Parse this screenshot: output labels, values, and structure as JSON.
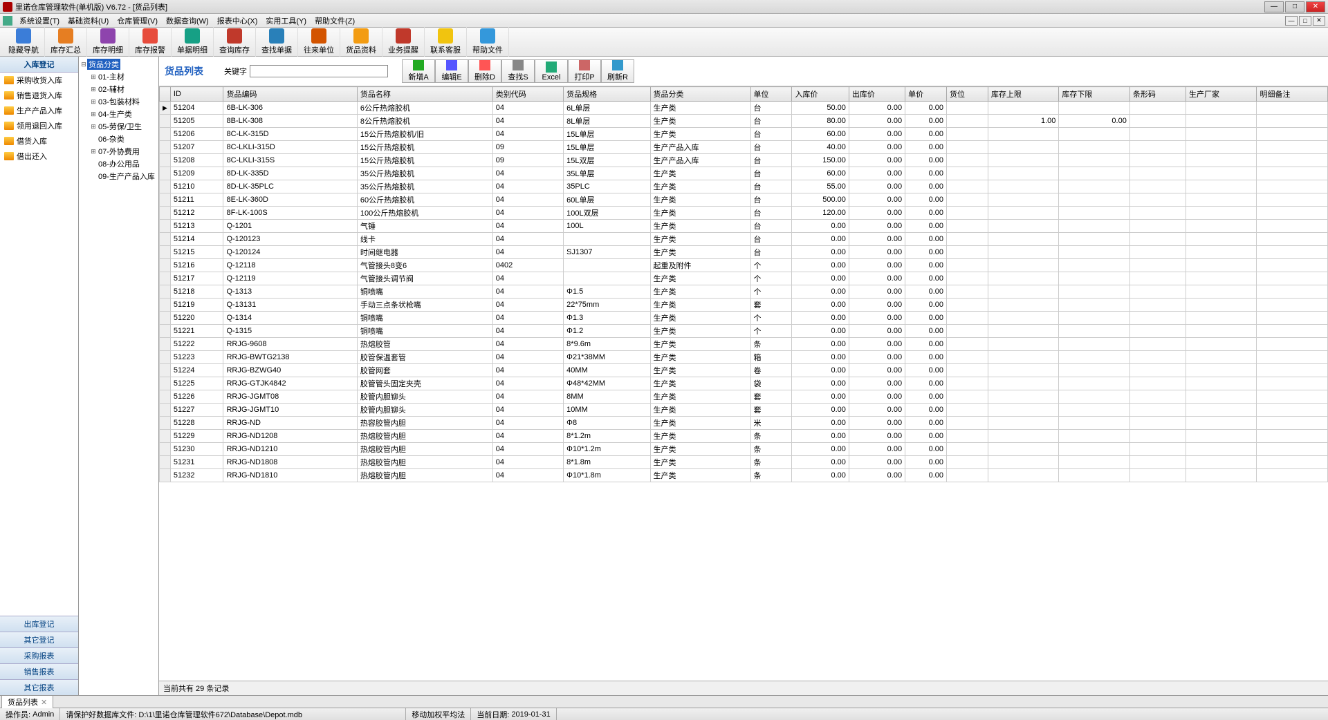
{
  "window": {
    "title": "里诺仓库管理软件(单机版) V6.72 - [货品列表]"
  },
  "menus": [
    "系统设置(T)",
    "基础资料(U)",
    "仓库管理(V)",
    "数据查询(W)",
    "报表中心(X)",
    "实用工具(Y)",
    "帮助文件(Z)"
  ],
  "toolbar": [
    {
      "label": "隐藏导航",
      "color": "#3b7dd8"
    },
    {
      "label": "库存汇总",
      "color": "#e67e22"
    },
    {
      "label": "库存明细",
      "color": "#8e44ad"
    },
    {
      "label": "库存报警",
      "color": "#e74c3c"
    },
    {
      "label": "单据明细",
      "color": "#16a085"
    },
    {
      "label": "查询库存",
      "color": "#c0392b"
    },
    {
      "label": "查找单据",
      "color": "#2980b9"
    },
    {
      "label": "往来单位",
      "color": "#d35400"
    },
    {
      "label": "货品资料",
      "color": "#f39c12"
    },
    {
      "label": "业务提醒",
      "color": "#c0392b"
    },
    {
      "label": "联系客服",
      "color": "#f1c40f"
    },
    {
      "label": "帮助文件",
      "color": "#3498db"
    }
  ],
  "sidebar": {
    "header": "入库登记",
    "items": [
      "采购收货入库",
      "销售退货入库",
      "生产产品入库",
      "领用退回入库",
      "借货入库",
      "借出还入"
    ],
    "bottom": [
      "出库登记",
      "其它登记",
      "采购报表",
      "销售报表",
      "其它报表"
    ]
  },
  "tree": {
    "root": "货品分类",
    "children": [
      {
        "exp": "+",
        "label": "01-主材"
      },
      {
        "exp": "+",
        "label": "02-辅材"
      },
      {
        "exp": "+",
        "label": "03-包装材料"
      },
      {
        "exp": "+",
        "label": "04-生产类"
      },
      {
        "exp": "+",
        "label": "05-劳保/卫生"
      },
      {
        "exp": "",
        "label": "06-杂类"
      },
      {
        "exp": "+",
        "label": "07-外协费用"
      },
      {
        "exp": "",
        "label": "08-办公用品"
      },
      {
        "exp": "",
        "label": "09-生产产品入库"
      }
    ]
  },
  "grid": {
    "title": "货品列表",
    "search_label": "关键字",
    "search_value": "",
    "actions": [
      "新增A",
      "编辑E",
      "删除D",
      "查找S",
      "Excel",
      "打印P",
      "刷新R"
    ],
    "columns": [
      "ID",
      "货品编码",
      "货品名称",
      "类别代码",
      "货品规格",
      "货品分类",
      "单位",
      "入库价",
      "出库价",
      "单价",
      "货位",
      "库存上限",
      "库存下限",
      "条形码",
      "生产厂家",
      "明细备注"
    ],
    "rows": [
      {
        "id": "51204",
        "code": "6B-LK-306",
        "name": "6公斤热熔胶机",
        "cat": "04",
        "spec": "6L单层",
        "cls": "生产类",
        "unit": "台",
        "in": "50.00",
        "out": "0.00",
        "price": "0.00",
        "loc": "",
        "up": "",
        "low": "",
        "bar": "",
        "mfg": "",
        "note": ""
      },
      {
        "id": "51205",
        "code": "8B-LK-308",
        "name": "8公斤热熔胶机",
        "cat": "04",
        "spec": "8L单层",
        "cls": "生产类",
        "unit": "台",
        "in": "80.00",
        "out": "0.00",
        "price": "0.00",
        "loc": "",
        "up": "1.00",
        "low": "0.00",
        "bar": "",
        "mfg": "",
        "note": ""
      },
      {
        "id": "51206",
        "code": "8C-LK-315D",
        "name": "15公斤热熔胶机/旧",
        "cat": "04",
        "spec": "15L单层",
        "cls": "生产类",
        "unit": "台",
        "in": "60.00",
        "out": "0.00",
        "price": "0.00",
        "loc": "",
        "up": "",
        "low": "",
        "bar": "",
        "mfg": "",
        "note": ""
      },
      {
        "id": "51207",
        "code": "8C-LKLI-315D",
        "name": "15公斤热熔胶机",
        "cat": "09",
        "spec": "15L单层",
        "cls": "生产产品入库",
        "unit": "台",
        "in": "40.00",
        "out": "0.00",
        "price": "0.00",
        "loc": "",
        "up": "",
        "low": "",
        "bar": "",
        "mfg": "",
        "note": ""
      },
      {
        "id": "51208",
        "code": "8C-LKLI-315S",
        "name": "15公斤热熔胶机",
        "cat": "09",
        "spec": "15L双层",
        "cls": "生产产品入库",
        "unit": "台",
        "in": "150.00",
        "out": "0.00",
        "price": "0.00",
        "loc": "",
        "up": "",
        "low": "",
        "bar": "",
        "mfg": "",
        "note": ""
      },
      {
        "id": "51209",
        "code": "8D-LK-335D",
        "name": "35公斤热熔胶机",
        "cat": "04",
        "spec": "35L单层",
        "cls": "生产类",
        "unit": "台",
        "in": "60.00",
        "out": "0.00",
        "price": "0.00",
        "loc": "",
        "up": "",
        "low": "",
        "bar": "",
        "mfg": "",
        "note": ""
      },
      {
        "id": "51210",
        "code": "8D-LK-35PLC",
        "name": "35公斤热熔胶机",
        "cat": "04",
        "spec": "35PLC",
        "cls": "生产类",
        "unit": "台",
        "in": "55.00",
        "out": "0.00",
        "price": "0.00",
        "loc": "",
        "up": "",
        "low": "",
        "bar": "",
        "mfg": "",
        "note": ""
      },
      {
        "id": "51211",
        "code": "8E-LK-360D",
        "name": "60公斤热熔胶机",
        "cat": "04",
        "spec": "60L单层",
        "cls": "生产类",
        "unit": "台",
        "in": "500.00",
        "out": "0.00",
        "price": "0.00",
        "loc": "",
        "up": "",
        "low": "",
        "bar": "",
        "mfg": "",
        "note": ""
      },
      {
        "id": "51212",
        "code": "8F-LK-100S",
        "name": "100公斤热熔胶机",
        "cat": "04",
        "spec": "100L双层",
        "cls": "生产类",
        "unit": "台",
        "in": "120.00",
        "out": "0.00",
        "price": "0.00",
        "loc": "",
        "up": "",
        "low": "",
        "bar": "",
        "mfg": "",
        "note": ""
      },
      {
        "id": "51213",
        "code": "Q-1201",
        "name": "气锤",
        "cat": "04",
        "spec": "100L",
        "cls": "生产类",
        "unit": "台",
        "in": "0.00",
        "out": "0.00",
        "price": "0.00",
        "loc": "",
        "up": "",
        "low": "",
        "bar": "",
        "mfg": "",
        "note": ""
      },
      {
        "id": "51214",
        "code": "Q-120123",
        "name": "线卡",
        "cat": "04",
        "spec": "",
        "cls": "生产类",
        "unit": "台",
        "in": "0.00",
        "out": "0.00",
        "price": "0.00",
        "loc": "",
        "up": "",
        "low": "",
        "bar": "",
        "mfg": "",
        "note": ""
      },
      {
        "id": "51215",
        "code": "Q-120124",
        "name": "时间继电器",
        "cat": "04",
        "spec": "SJ1307",
        "cls": "生产类",
        "unit": "台",
        "in": "0.00",
        "out": "0.00",
        "price": "0.00",
        "loc": "",
        "up": "",
        "low": "",
        "bar": "",
        "mfg": "",
        "note": ""
      },
      {
        "id": "51216",
        "code": "Q-12118",
        "name": "气管接头8变6",
        "cat": "0402",
        "spec": "",
        "cls": "起重及附件",
        "unit": "个",
        "in": "0.00",
        "out": "0.00",
        "price": "0.00",
        "loc": "",
        "up": "",
        "low": "",
        "bar": "",
        "mfg": "",
        "note": ""
      },
      {
        "id": "51217",
        "code": "Q-12119",
        "name": "气管接头调节阀",
        "cat": "04",
        "spec": "",
        "cls": "生产类",
        "unit": "个",
        "in": "0.00",
        "out": "0.00",
        "price": "0.00",
        "loc": "",
        "up": "",
        "low": "",
        "bar": "",
        "mfg": "",
        "note": ""
      },
      {
        "id": "51218",
        "code": "Q-1313",
        "name": "铜喷嘴",
        "cat": "04",
        "spec": "Φ1.5",
        "cls": "生产类",
        "unit": "个",
        "in": "0.00",
        "out": "0.00",
        "price": "0.00",
        "loc": "",
        "up": "",
        "low": "",
        "bar": "",
        "mfg": "",
        "note": ""
      },
      {
        "id": "51219",
        "code": "Q-13131",
        "name": "手动三点条状枪嘴",
        "cat": "04",
        "spec": "22*75mm",
        "cls": "生产类",
        "unit": "套",
        "in": "0.00",
        "out": "0.00",
        "price": "0.00",
        "loc": "",
        "up": "",
        "low": "",
        "bar": "",
        "mfg": "",
        "note": ""
      },
      {
        "id": "51220",
        "code": "Q-1314",
        "name": "铜喷嘴",
        "cat": "04",
        "spec": "Φ1.3",
        "cls": "生产类",
        "unit": "个",
        "in": "0.00",
        "out": "0.00",
        "price": "0.00",
        "loc": "",
        "up": "",
        "low": "",
        "bar": "",
        "mfg": "",
        "note": ""
      },
      {
        "id": "51221",
        "code": "Q-1315",
        "name": "铜喷嘴",
        "cat": "04",
        "spec": "Φ1.2",
        "cls": "生产类",
        "unit": "个",
        "in": "0.00",
        "out": "0.00",
        "price": "0.00",
        "loc": "",
        "up": "",
        "low": "",
        "bar": "",
        "mfg": "",
        "note": ""
      },
      {
        "id": "51222",
        "code": "RRJG-9608",
        "name": "热熔胶管",
        "cat": "04",
        "spec": "8*9.6m",
        "cls": "生产类",
        "unit": "条",
        "in": "0.00",
        "out": "0.00",
        "price": "0.00",
        "loc": "",
        "up": "",
        "low": "",
        "bar": "",
        "mfg": "",
        "note": ""
      },
      {
        "id": "51223",
        "code": "RRJG-BWTG2138",
        "name": "胶管保温套管",
        "cat": "04",
        "spec": "Φ21*38MM",
        "cls": "生产类",
        "unit": "箱",
        "in": "0.00",
        "out": "0.00",
        "price": "0.00",
        "loc": "",
        "up": "",
        "low": "",
        "bar": "",
        "mfg": "",
        "note": ""
      },
      {
        "id": "51224",
        "code": "RRJG-BZWG40",
        "name": "胶管网套",
        "cat": "04",
        "spec": "40MM",
        "cls": "生产类",
        "unit": "卷",
        "in": "0.00",
        "out": "0.00",
        "price": "0.00",
        "loc": "",
        "up": "",
        "low": "",
        "bar": "",
        "mfg": "",
        "note": ""
      },
      {
        "id": "51225",
        "code": "RRJG-GTJK4842",
        "name": "胶管管头固定夹壳",
        "cat": "04",
        "spec": "Φ48*42MM",
        "cls": "生产类",
        "unit": "袋",
        "in": "0.00",
        "out": "0.00",
        "price": "0.00",
        "loc": "",
        "up": "",
        "low": "",
        "bar": "",
        "mfg": "",
        "note": ""
      },
      {
        "id": "51226",
        "code": "RRJG-JGMT08",
        "name": "胶管内胆铆头",
        "cat": "04",
        "spec": "8MM",
        "cls": "生产类",
        "unit": "套",
        "in": "0.00",
        "out": "0.00",
        "price": "0.00",
        "loc": "",
        "up": "",
        "low": "",
        "bar": "",
        "mfg": "",
        "note": ""
      },
      {
        "id": "51227",
        "code": "RRJG-JGMT10",
        "name": "胶管内胆铆头",
        "cat": "04",
        "spec": "10MM",
        "cls": "生产类",
        "unit": "套",
        "in": "0.00",
        "out": "0.00",
        "price": "0.00",
        "loc": "",
        "up": "",
        "low": "",
        "bar": "",
        "mfg": "",
        "note": ""
      },
      {
        "id": "51228",
        "code": "RRJG-ND",
        "name": "热容胶管内胆",
        "cat": "04",
        "spec": "Φ8",
        "cls": "生产类",
        "unit": "米",
        "in": "0.00",
        "out": "0.00",
        "price": "0.00",
        "loc": "",
        "up": "",
        "low": "",
        "bar": "",
        "mfg": "",
        "note": ""
      },
      {
        "id": "51229",
        "code": "RRJG-ND1208",
        "name": "热熔胶管内胆",
        "cat": "04",
        "spec": "8*1.2m",
        "cls": "生产类",
        "unit": "条",
        "in": "0.00",
        "out": "0.00",
        "price": "0.00",
        "loc": "",
        "up": "",
        "low": "",
        "bar": "",
        "mfg": "",
        "note": ""
      },
      {
        "id": "51230",
        "code": "RRJG-ND1210",
        "name": "热熔胶管内胆",
        "cat": "04",
        "spec": "Φ10*1.2m",
        "cls": "生产类",
        "unit": "条",
        "in": "0.00",
        "out": "0.00",
        "price": "0.00",
        "loc": "",
        "up": "",
        "low": "",
        "bar": "",
        "mfg": "",
        "note": ""
      },
      {
        "id": "51231",
        "code": "RRJG-ND1808",
        "name": "热熔胶管内胆",
        "cat": "04",
        "spec": "8*1.8m",
        "cls": "生产类",
        "unit": "条",
        "in": "0.00",
        "out": "0.00",
        "price": "0.00",
        "loc": "",
        "up": "",
        "low": "",
        "bar": "",
        "mfg": "",
        "note": ""
      },
      {
        "id": "51232",
        "code": "RRJG-ND1810",
        "name": "热熔胶管内胆",
        "cat": "04",
        "spec": "Φ10*1.8m",
        "cls": "生产类",
        "unit": "条",
        "in": "0.00",
        "out": "0.00",
        "price": "0.00",
        "loc": "",
        "up": "",
        "low": "",
        "bar": "",
        "mfg": "",
        "note": ""
      }
    ],
    "footer": "当前共有 29 条记录"
  },
  "bottom_tab": "货品列表",
  "status": {
    "operator_label": "操作员:",
    "operator": "Admin",
    "backup": "请保护好数据库文件: D:\\1\\里诺仓库管理软件672\\Database\\Depot.mdb",
    "method": "移动加权平均法",
    "date_label": "当前日期:",
    "date": "2019-01-31"
  }
}
